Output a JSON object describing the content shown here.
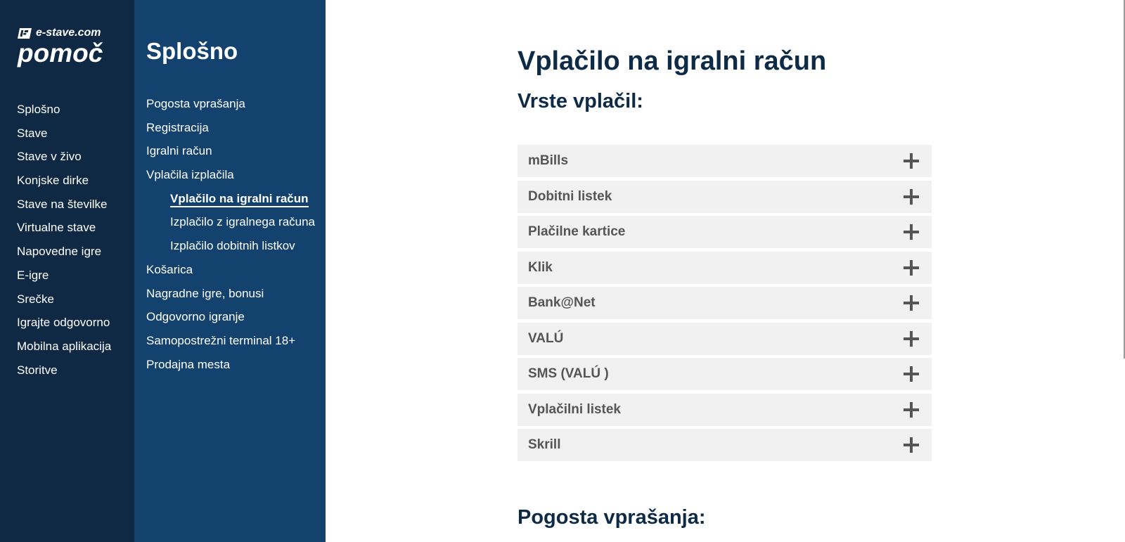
{
  "logo": {
    "site": "e-stave.com",
    "title": "pomoč"
  },
  "main_nav": {
    "items": [
      "Splošno",
      "Stave",
      "Stave v živo",
      "Konjske dirke",
      "Stave na številke",
      "Virtualne stave",
      "Napovedne igre",
      "E-igre",
      "Srečke",
      "Igrajte odgovorno",
      "Mobilna aplikacija",
      "Storitve"
    ]
  },
  "sub_nav": {
    "title": "Splošno",
    "items": [
      {
        "label": "Pogosta vprašanja",
        "indent": false,
        "active": false
      },
      {
        "label": "Registracija",
        "indent": false,
        "active": false
      },
      {
        "label": "Igralni račun",
        "indent": false,
        "active": false
      },
      {
        "label": "Vplačila izplačila",
        "indent": false,
        "active": false
      },
      {
        "label": "Vplačilo na igralni račun",
        "indent": true,
        "active": true
      },
      {
        "label": "Izplačilo z igralnega računa",
        "indent": true,
        "active": false
      },
      {
        "label": "Izplačilo dobitnih listkov",
        "indent": true,
        "active": false
      },
      {
        "label": "Košarica",
        "indent": false,
        "active": false
      },
      {
        "label": "Nagradne igre, bonusi",
        "indent": false,
        "active": false
      },
      {
        "label": "Odgovorno igranje",
        "indent": false,
        "active": false
      },
      {
        "label": "Samopostrežni terminal 18+",
        "indent": false,
        "active": false
      },
      {
        "label": "Prodajna mesta",
        "indent": false,
        "active": false
      }
    ]
  },
  "content": {
    "page_title": "Vplačilo na igralni račun",
    "types_heading": "Vrste vplačil:",
    "payment_types": [
      "mBills",
      "Dobitni listek",
      "Plačilne kartice",
      "Klik",
      "Bank@Net",
      "VALÚ",
      "SMS (VALÚ )",
      "Vplačilni listek",
      "Skrill"
    ],
    "faq_heading": "Pogosta vprašanja:"
  },
  "colors": {
    "main_nav_bg": "#0f2844",
    "sub_nav_bg": "#13426f",
    "heading": "#0d2a47",
    "accordion_bg": "#f1f1f1",
    "accordion_text": "#555555"
  },
  "icons": {
    "logo_mark": "e-stave-logo-icon",
    "expand": "plus-icon"
  }
}
